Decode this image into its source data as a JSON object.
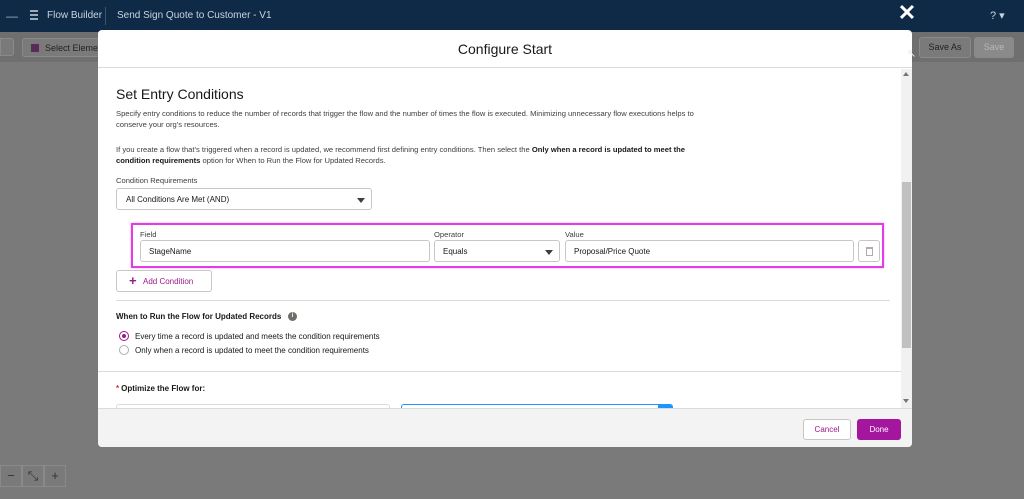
{
  "topbar": {
    "app_name": "Flow Builder",
    "flow_title": "Send Sign Quote to Customer - V1",
    "help_label": "? ▾"
  },
  "toolbar": {
    "select_elements_label": "Select Elements",
    "save_as_label": "Save As",
    "save_label": "Save"
  },
  "modal": {
    "title": "Configure Start",
    "section_title": "Set Entry Conditions",
    "description_1": "Specify entry conditions to reduce the number of records that trigger the flow and the number of times the flow is executed. Minimizing unnecessary flow executions helps to conserve your org's resources.",
    "description_2_pre": "If you create a flow that's triggered when a record is updated, we recommend first defining entry conditions. Then select the ",
    "description_2_bold": "Only when a record is updated to meet the condition requirements",
    "description_2_post": " option for When to Run the Flow for Updated Records.",
    "condition_requirements_label": "Condition Requirements",
    "condition_requirements_value": "All Conditions Are Met (AND)",
    "condition": {
      "field_label": "Field",
      "field_value": "StageName",
      "operator_label": "Operator",
      "operator_value": "Equals",
      "value_label": "Value",
      "value_value": "Proposal/Price Quote"
    },
    "add_condition_label": "Add Condition",
    "when_to_run_title": "When to Run the Flow for Updated Records",
    "radio_options": [
      {
        "label": "Every time a record is updated and meets the condition requirements",
        "selected": true
      },
      {
        "label": "Only when a record is updated to meet the condition requirements",
        "selected": false
      }
    ],
    "optimize_title": "Optimize the Flow for:",
    "required_marker": "*",
    "cancel_label": "Cancel",
    "done_label": "Done"
  },
  "colors": {
    "nav_bg": "#0e2a47",
    "brand_purple": "#a5169e",
    "highlight": "#e13ce6",
    "overlay_gray": "#7a7a7a"
  }
}
